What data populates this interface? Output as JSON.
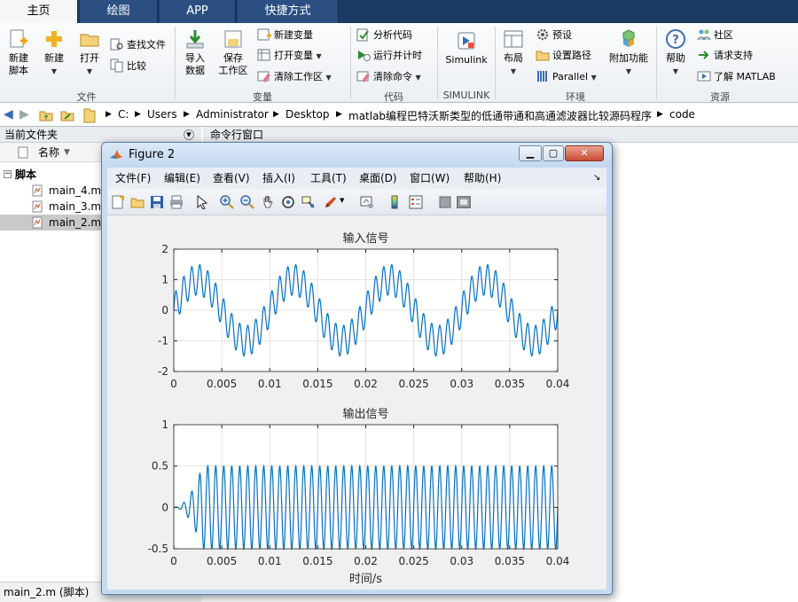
{
  "tabs": [
    {
      "label": "主页",
      "active": true
    },
    {
      "label": "绘图",
      "active": false
    },
    {
      "label": "APP",
      "active": false
    },
    {
      "label": "快捷方式",
      "active": false
    }
  ],
  "ribbon": {
    "new_script": "新建\n脚本",
    "new": "新建",
    "open": "打开",
    "find_files": "查找文件",
    "compare": "比较",
    "import_data": "导入\n数据",
    "save_workspace": "保存\n工作区",
    "new_variable": "新建变量",
    "open_variable": "打开变量",
    "clear_workspace": "清除工作区",
    "analyze_code": "分析代码",
    "run_and_time": "运行并计时",
    "clear_commands": "清除命令",
    "simulink": "Simulink",
    "layout": "布局",
    "preferences": "预设",
    "set_path": "设置路径",
    "parallel": "Parallel",
    "add_ons": "附加功能",
    "help": "帮助",
    "community": "社区",
    "request_support": "请求支持",
    "learn_matlab": "了解 MATLAB",
    "groups": {
      "file": "文件",
      "variable": "变量",
      "code": "代码",
      "simulink": "SIMULINK",
      "environment": "环境",
      "resources": "资源"
    }
  },
  "address": {
    "crumbs": [
      "C:",
      "Users",
      "Administrator",
      "Desktop",
      "matlab编程巴特沃斯类型的低通带通和高通滤波器比较源码程序",
      "code"
    ]
  },
  "left_panel": {
    "title": "当前文件夹",
    "column": "名称",
    "folder": "脚本",
    "files": [
      "main_4.m",
      "main_3.m",
      "main_2.m"
    ],
    "selected": "main_2.m",
    "status": "main_2.m  (脚本)"
  },
  "command_window": {
    "title": "命令行窗口"
  },
  "figure": {
    "title": "Figure 2",
    "menu": [
      "文件(F)",
      "编辑(E)",
      "查看(V)",
      "插入(I)",
      "工具(T)",
      "桌面(D)",
      "窗口(W)",
      "帮助(H)"
    ]
  },
  "chart_data": [
    {
      "type": "line",
      "title": "输入信号",
      "xlabel": "",
      "ylabel": "",
      "xlim": [
        0,
        0.04
      ],
      "ylim": [
        -2,
        2
      ],
      "xticks": [
        0,
        0.005,
        0.01,
        0.015,
        0.02,
        0.025,
        0.03,
        0.035,
        0.04
      ],
      "xtick_labels": [
        "0",
        "0.005",
        "0.01",
        "0.015",
        "0.02",
        "0.025",
        "0.03",
        "0.035",
        "0.04"
      ],
      "yticks": [
        -2,
        -1,
        0,
        1,
        2
      ],
      "ytick_labels": [
        "-2",
        "-1",
        "0",
        "1",
        "2"
      ],
      "grid": true,
      "color": "#0072bd",
      "series": [
        {
          "components": [
            {
              "amplitude": 1,
              "frequency_hz": 100
            },
            {
              "amplitude": 0.5,
              "frequency_hz": 1200
            }
          ]
        }
      ]
    },
    {
      "type": "line",
      "title": "输出信号",
      "xlabel": "时间/s",
      "ylabel": "",
      "xlim": [
        0,
        0.04
      ],
      "ylim": [
        -0.5,
        1
      ],
      "xticks": [
        0,
        0.005,
        0.01,
        0.015,
        0.02,
        0.025,
        0.03,
        0.035,
        0.04
      ],
      "xtick_labels": [
        "0",
        "0.005",
        "0.01",
        "0.015",
        "0.02",
        "0.025",
        "0.03",
        "0.035",
        "0.04"
      ],
      "yticks": [
        -0.5,
        0,
        0.5,
        1
      ],
      "ytick_labels": [
        "-0.5",
        "0",
        "0.5",
        "1"
      ],
      "grid": true,
      "color": "#0072bd",
      "series": [
        {
          "steady_amplitude": 0.5,
          "frequency_hz": 1200,
          "settle_time_s": 0.003
        }
      ]
    }
  ]
}
